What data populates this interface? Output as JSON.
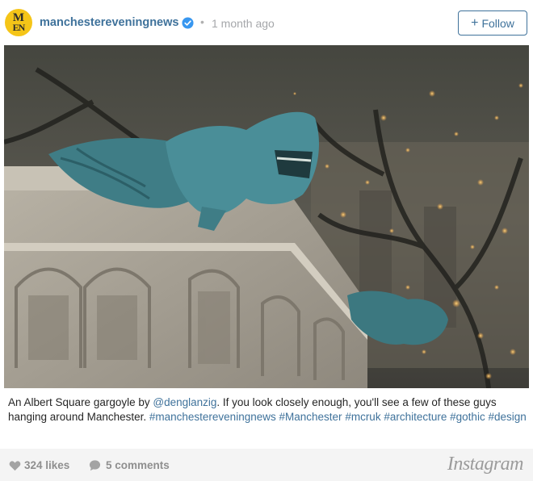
{
  "header": {
    "avatar_text_top": "M",
    "avatar_text_bottom": "EN",
    "username": "manchestereveningnews",
    "separator": "•",
    "timestamp": "1 month ago",
    "follow_plus": "+",
    "follow_label": "Follow"
  },
  "caption": {
    "text_1": "An Albert Square gargoyle by ",
    "mention": "@denglanzig",
    "text_2": ". If you look closely enough, you'll see a few of these guys hanging around Manchester. ",
    "hashtags": [
      "#manchestereveningnews",
      "#Manchester",
      "#mcruk",
      "#architecture",
      "#gothic",
      "#design"
    ]
  },
  "footer": {
    "likes": "324 likes",
    "comments": "5 comments",
    "brand": "Instagram"
  },
  "colors": {
    "link": "#3f729b",
    "verified": "#3897f0",
    "avatar_bg": "#f5c518",
    "footer_bg": "#f4f4f4"
  },
  "icons": {
    "verified": "verified-badge-icon",
    "heart": "heart-icon",
    "comment": "comment-bubble-icon"
  }
}
